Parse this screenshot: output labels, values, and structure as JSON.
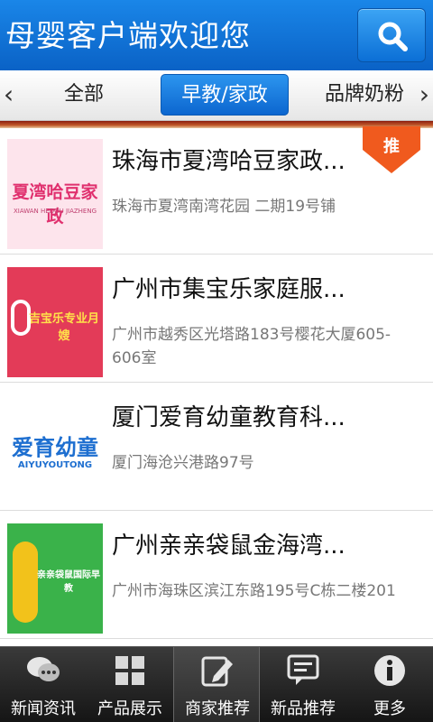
{
  "header": {
    "title": "母婴客户端欢迎您",
    "search_icon": "search-icon"
  },
  "categories": {
    "items": [
      {
        "label": "全部",
        "active": false
      },
      {
        "label": "早教/家政",
        "active": true
      },
      {
        "label": "品牌奶粉",
        "active": false
      }
    ],
    "left_arrow": "‹",
    "right_arrow": "›"
  },
  "list": {
    "items": [
      {
        "name": "珠海市夏湾哈豆家政...",
        "address": "珠海市夏湾南湾花园 二期19号铺",
        "badge": "推",
        "thumb_text": "夏湾哈豆家政",
        "thumb_sub": "XIAWAN HEDOU JIAZHENG"
      },
      {
        "name": "广州市集宝乐家庭服...",
        "address": "广州市越秀区光塔路183号樱花大厦605-606室",
        "thumb_text": "吉宝乐专业月嫂"
      },
      {
        "name": "厦门爱育幼童教育科...",
        "address": "厦门海沧兴港路97号",
        "thumb_text": "爱育幼童",
        "thumb_sub": "AIYUYOUTONG"
      },
      {
        "name": "广州亲亲袋鼠金海湾...",
        "address": "广州市海珠区滨江东路195号C栋二楼201",
        "thumb_text": "亲亲袋鼠国际早教"
      }
    ]
  },
  "bottom_nav": {
    "items": [
      {
        "label": "新闻资讯",
        "icon": "chat-bubbles-icon"
      },
      {
        "label": "产品展示",
        "icon": "grid-icon"
      },
      {
        "label": "商家推荐",
        "icon": "edit-icon",
        "active": true
      },
      {
        "label": "新品推荐",
        "icon": "message-icon"
      },
      {
        "label": "更多",
        "icon": "info-icon"
      }
    ]
  },
  "colors": {
    "header_blue": "#0a62c6",
    "active_tab": "#1a7fe0",
    "badge_orange": "#f05a1e"
  }
}
